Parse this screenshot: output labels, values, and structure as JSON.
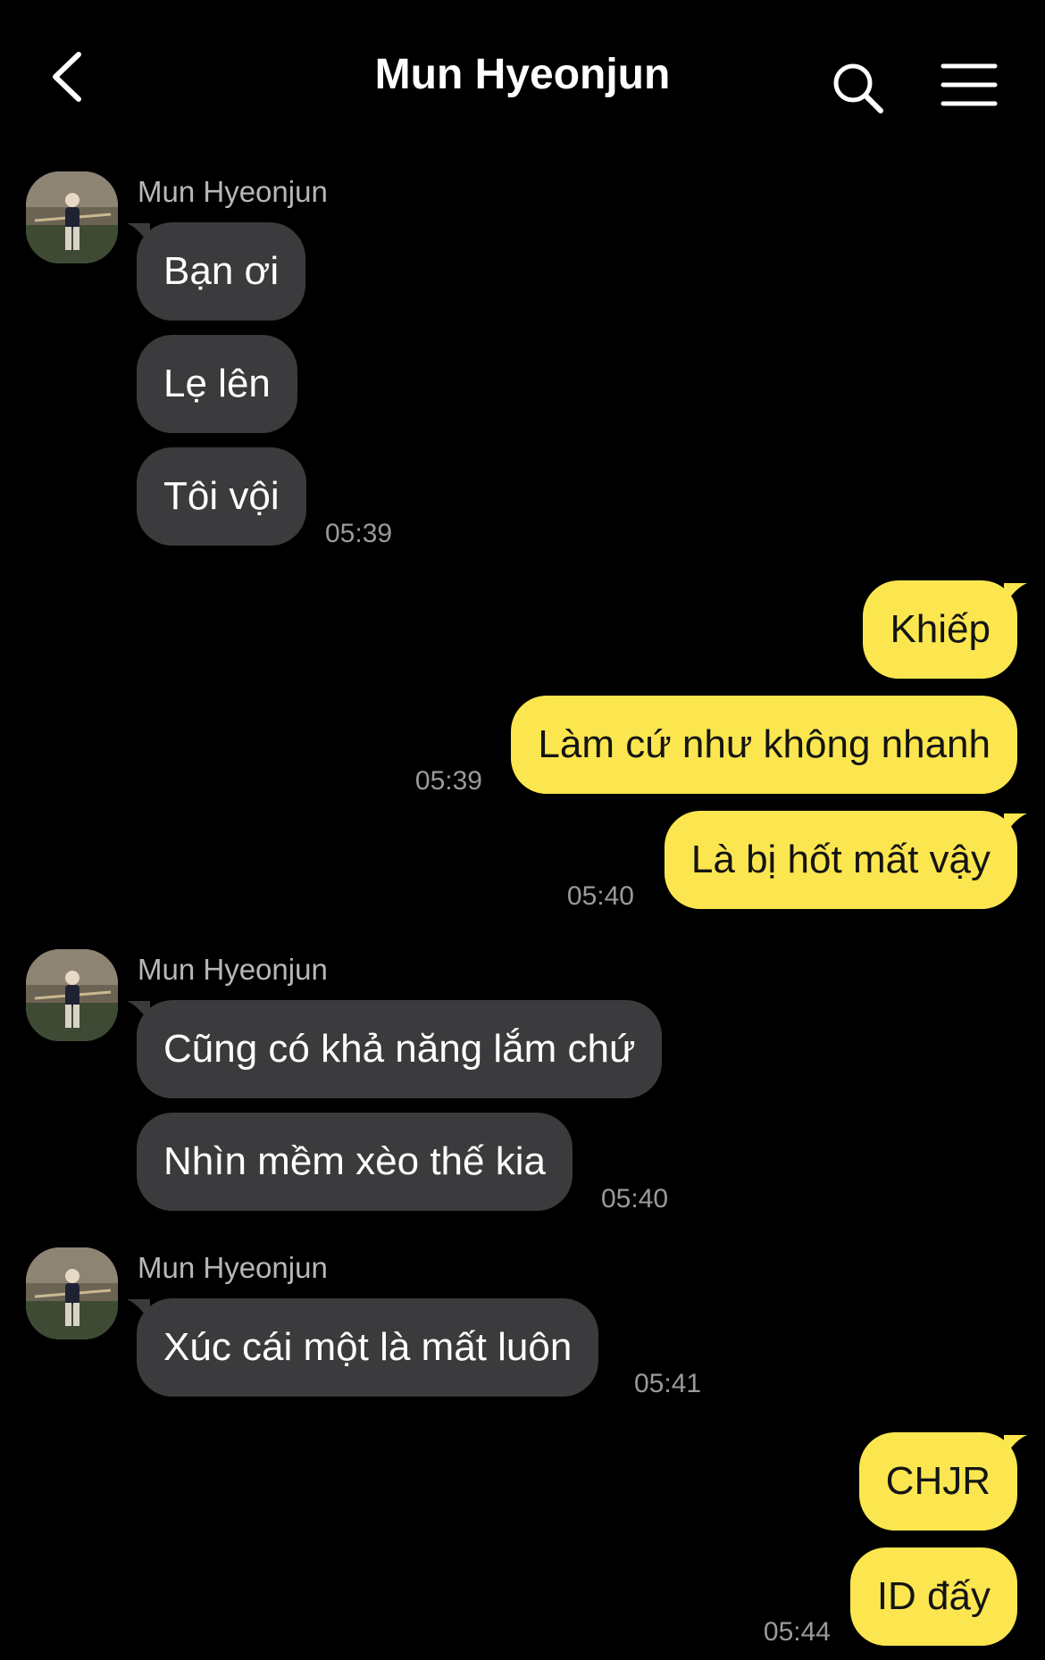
{
  "header": {
    "title": "Mun Hyeonjun",
    "back_icon": "chevron-left-icon",
    "search_icon": "search-icon",
    "menu_icon": "hamburger-menu-icon"
  },
  "colors": {
    "background": "#000000",
    "incoming_bubble": "#3b3b3d",
    "outgoing_bubble": "#fbe64f",
    "timestamp": "#9a9a9a",
    "sender_name": "#b7b7b7"
  },
  "messages": {
    "g1": {
      "sender": "Mun Hyeonjun",
      "m1": "Bạn ơi",
      "m2": "Lẹ lên",
      "m3": "Tôi vội",
      "time": "05:39"
    },
    "o1": {
      "m1": "Khiếp",
      "m2": "Làm cứ như không nhanh",
      "time": "05:39"
    },
    "o2": {
      "m1": "Là bị hốt mất vậy",
      "time": "05:40"
    },
    "g2": {
      "sender": "Mun Hyeonjun",
      "m1": "Cũng có khả năng lắm chứ",
      "m2": "Nhìn mềm xèo thế kia",
      "time": "05:40"
    },
    "g3": {
      "sender": "Mun Hyeonjun",
      "m1": "Xúc cái một là mất luôn",
      "time": "05:41"
    },
    "o3": {
      "m1": "CHJR",
      "m2": "ID đấy",
      "time": "05:44"
    }
  }
}
